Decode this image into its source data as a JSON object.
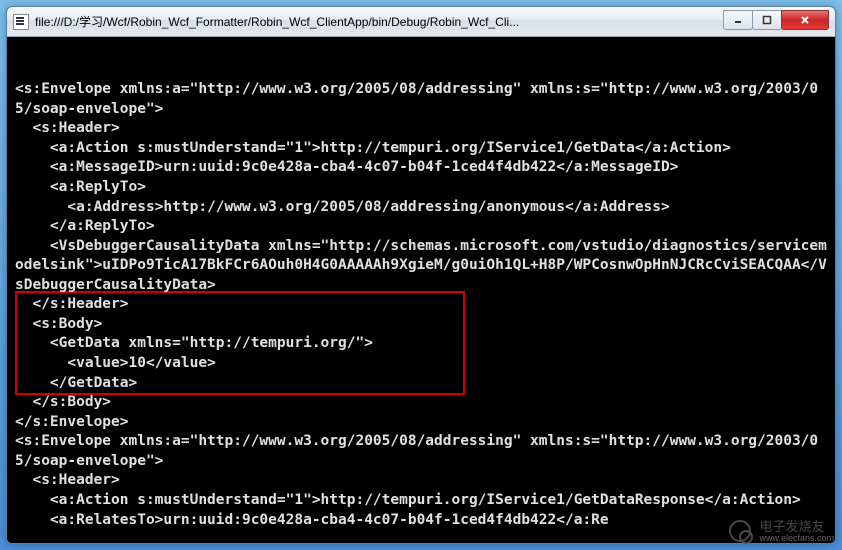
{
  "window": {
    "title": "file:///D:/学习/Wcf/Robin_Wcf_Formatter/Robin_Wcf_ClientApp/bin/Debug/Robin_Wcf_Cli..."
  },
  "console": {
    "line1": "<s:Envelope xmlns:a=\"http://www.w3.org/2005/08/addressing\" xmlns:s=\"http://www.w3.org/2003/05/soap-envelope\">",
    "line2": "  <s:Header>",
    "line3": "    <a:Action s:mustUnderstand=\"1\">http://tempuri.org/IService1/GetData</a:Action>",
    "line4": "    <a:MessageID>urn:uuid:9c0e428a-cba4-4c07-b04f-1ced4f4db422</a:MessageID>",
    "line5": "    <a:ReplyTo>",
    "line6": "      <a:Address>http://www.w3.org/2005/08/addressing/anonymous</a:Address>",
    "line7": "    </a:ReplyTo>",
    "line8": "    <VsDebuggerCausalityData xmlns=\"http://schemas.microsoft.com/vstudio/diagnostics/servicemodelsink\">uIDPo9TicA17BkFCr6AOuh0H4G0AAAAAh9XgieM/g0uiOh1QL+H8P/WPCosnwOpHnNJCRcCviSEACQAA</VsDebuggerCausalityData>",
    "line9": "  </s:Header>",
    "line10": "  <s:Body>",
    "line11": "    <GetData xmlns=\"http://tempuri.org/\">",
    "line12": "      <value>10</value>",
    "line13": "    </GetData>",
    "line14": "  </s:Body>",
    "line15": "</s:Envelope>",
    "line16": "<s:Envelope xmlns:a=\"http://www.w3.org/2005/08/addressing\" xmlns:s=\"http://www.w3.org/2003/05/soap-envelope\">",
    "line17": "  <s:Header>",
    "line18": "    <a:Action s:mustUnderstand=\"1\">http://tempuri.org/IService1/GetDataResponse</a:Action>",
    "line19": "    <a:RelatesTo>urn:uuid:9c0e428a-cba4-4c07-b04f-1ced4f4db422</a:Re"
  },
  "watermark": {
    "brand": "电子发烧友",
    "url": "www.elecfans.com"
  }
}
